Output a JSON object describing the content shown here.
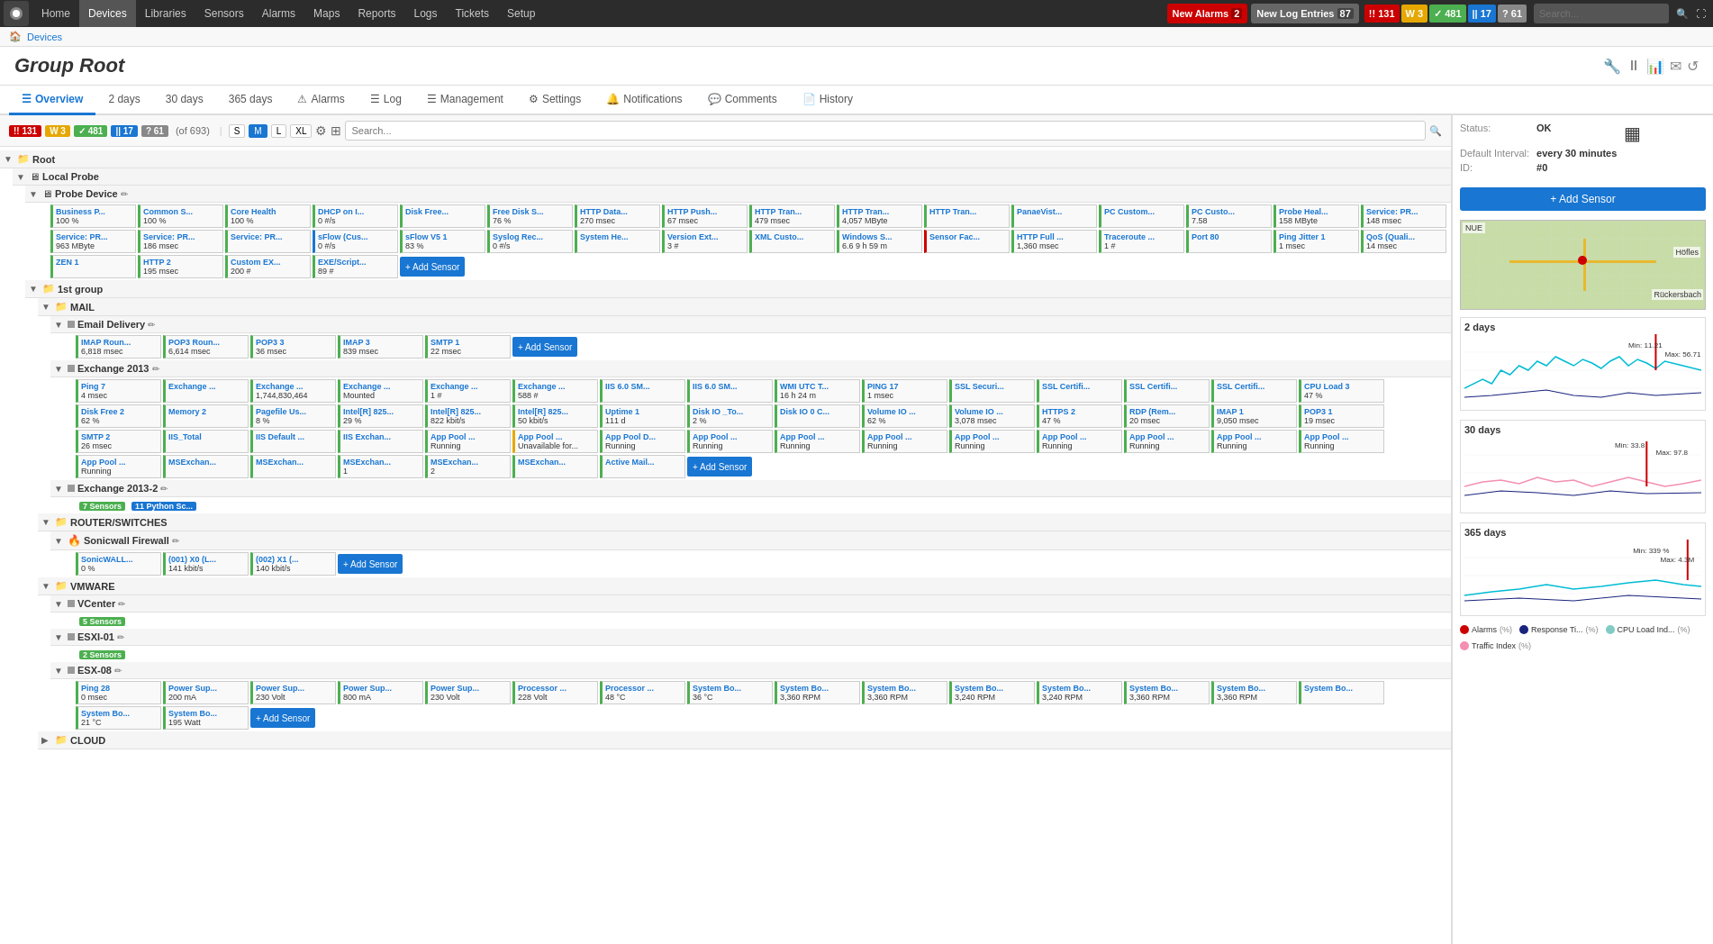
{
  "nav": {
    "logo": "⬤",
    "items": [
      "Home",
      "Devices",
      "Libraries",
      "Sensors",
      "Alarms",
      "Maps",
      "Reports",
      "Logs",
      "Tickets",
      "Setup"
    ],
    "active": "Devices"
  },
  "topbar": {
    "new_alarms_label": "New Alarms",
    "new_alarms_count": "2",
    "new_log_label": "New Log Entries",
    "new_log_count": "87",
    "badges": [
      {
        "value": "131",
        "type": "red",
        "prefix": "!!"
      },
      {
        "value": "3",
        "type": "yellow",
        "prefix": "W"
      },
      {
        "value": "481",
        "type": "green",
        "prefix": "✓"
      },
      {
        "value": "17",
        "type": "blue",
        "prefix": "||"
      },
      {
        "value": "61",
        "type": "gray",
        "prefix": "?"
      }
    ],
    "search_placeholder": "Search..."
  },
  "breadcrumb": [
    "Devices"
  ],
  "page_title": {
    "italic": "Group",
    "normal": " Root"
  },
  "tabs": [
    {
      "label": "Overview",
      "icon": "☰",
      "active": true
    },
    {
      "label": "2 days",
      "icon": ""
    },
    {
      "label": "30 days",
      "icon": ""
    },
    {
      "label": "365 days",
      "icon": ""
    },
    {
      "label": "Alarms",
      "icon": "⚠"
    },
    {
      "label": "Log",
      "icon": "☰"
    },
    {
      "label": "Management",
      "icon": "☰"
    },
    {
      "label": "Settings",
      "icon": "⚙"
    },
    {
      "label": "Notifications",
      "icon": "🔔"
    },
    {
      "label": "Comments",
      "icon": "💬"
    },
    {
      "label": "History",
      "icon": "📄"
    }
  ],
  "toolbar": {
    "counts": [
      {
        "val": "131",
        "type": "red",
        "prefix": "!!"
      },
      {
        "val": "3",
        "type": "yellow",
        "prefix": "W"
      },
      {
        "val": "481",
        "type": "green",
        "prefix": "✓"
      },
      {
        "val": "17",
        "type": "blue",
        "prefix": "||"
      },
      {
        "val": "61",
        "type": "gray",
        "prefix": "?"
      }
    ],
    "of_label": "(of 693)",
    "sizes": [
      "S",
      "M",
      "L",
      "XL"
    ],
    "active_size": "M",
    "search_placeholder": "Search..."
  },
  "status_panel": {
    "status_label": "Status:",
    "status_value": "OK",
    "interval_label": "Default Interval:",
    "interval_value": "every 30 minutes",
    "id_label": "ID:",
    "id_value": "#0",
    "add_sensor_label": "+ Add Sensor"
  },
  "tree": {
    "root_label": "Root",
    "local_probe_label": "Local Probe",
    "probe_device_label": "Probe Device",
    "group1_label": "1st group",
    "mail_label": "MAIL",
    "email_delivery_label": "Email Delivery",
    "exchange2013_label": "Exchange 2013",
    "exchange2013_2_label": "Exchange 2013-2",
    "router_label": "ROUTER/SWITCHES",
    "sonicwall_label": "Sonicwall Firewall",
    "vmware_label": "VMWARE",
    "vcenter_label": "VCenter",
    "esxi01_label": "ESXI-01",
    "esx08_label": "ESX-08",
    "cloud_label": "CLOUD"
  },
  "probe_tiles": [
    {
      "name": "Business P...",
      "value": "100 %",
      "status": "green"
    },
    {
      "name": "Common S...",
      "value": "100 %",
      "status": "green"
    },
    {
      "name": "Core Health",
      "value": "100 %",
      "status": "green"
    },
    {
      "name": "DHCP on I...",
      "value": "0 #/s",
      "status": "green"
    },
    {
      "name": "Disk Free...",
      "value": "",
      "status": "green"
    },
    {
      "name": "Free Disk S...",
      "value": "76 %",
      "status": "green"
    },
    {
      "name": "HTTP Data...",
      "value": "270 msec",
      "status": "green"
    },
    {
      "name": "HTTP Push...",
      "value": "67 msec",
      "status": "green"
    },
    {
      "name": "HTTP Tran...",
      "value": "479 msec",
      "status": "green"
    },
    {
      "name": "HTTP Tran...",
      "value": "4,057 MByte",
      "status": "green"
    },
    {
      "name": "HTTP Tran...",
      "value": "",
      "status": "green"
    },
    {
      "name": "PanaeVist...",
      "value": "",
      "status": "green"
    },
    {
      "name": "PC Custom...",
      "value": "",
      "status": "green"
    },
    {
      "name": "PC Custo...",
      "value": "7.58",
      "status": "green"
    },
    {
      "name": "Probe Heal...",
      "value": "158 MByte",
      "status": "green"
    },
    {
      "name": "Service: PR...",
      "value": "148 msec",
      "status": "green"
    },
    {
      "name": "Service: PR...",
      "value": "963 MByte",
      "status": "green"
    },
    {
      "name": "Service: PR...",
      "value": "186 msec",
      "status": "green"
    },
    {
      "name": "Service: PR...",
      "value": "",
      "status": "green"
    },
    {
      "name": "sFlow (Cus...",
      "value": "0 #/s",
      "status": "blue"
    },
    {
      "name": "sFlow V5 1",
      "value": "83 %",
      "status": "green"
    },
    {
      "name": "Syslog Rec...",
      "value": "0 #/s",
      "status": "green"
    },
    {
      "name": "System He...",
      "value": "",
      "status": "green"
    },
    {
      "name": "Version Ext...",
      "value": "3 #",
      "status": "green"
    },
    {
      "name": "XML Custo...",
      "value": "",
      "status": "green"
    },
    {
      "name": "Windows S...",
      "value": "6.6 9 h 59 m",
      "status": "green"
    },
    {
      "name": "Sensor Fac...",
      "value": "",
      "status": "red"
    },
    {
      "name": "HTTP Full ...",
      "value": "1,360 msec",
      "status": "green"
    },
    {
      "name": "Traceroute ...",
      "value": "1 #",
      "status": "green"
    },
    {
      "name": "Port 80",
      "value": "",
      "status": "green"
    },
    {
      "name": "Ping Jitter 1",
      "value": "1 msec",
      "status": "green"
    },
    {
      "name": "QoS (Quali...",
      "value": "14 msec",
      "status": "green"
    },
    {
      "name": "ZEN 1",
      "value": "",
      "status": "green"
    },
    {
      "name": "HTTP 2",
      "value": "195 msec",
      "status": "green"
    },
    {
      "name": "Custom EX...",
      "value": "200 #",
      "status": "green"
    },
    {
      "name": "EXE/Script...",
      "value": "89 #",
      "status": "green"
    }
  ],
  "email_delivery_tiles": [
    {
      "name": "IMAP Roun...",
      "value": "6,818 msec",
      "status": "green"
    },
    {
      "name": "POP3 Roun...",
      "value": "6,614 msec",
      "status": "green"
    },
    {
      "name": "POP3 3",
      "value": "36 msec",
      "status": "green"
    },
    {
      "name": "IMAP 3",
      "value": "839 msec",
      "status": "green"
    },
    {
      "name": "SMTP 1",
      "value": "22 msec",
      "status": "green"
    }
  ],
  "exchange_tiles": [
    {
      "name": "Ping 7",
      "value": "4 msec",
      "status": "green"
    },
    {
      "name": "Exchange ...",
      "value": "",
      "status": "green"
    },
    {
      "name": "Exchange ...",
      "value": "1,744,830,464",
      "status": "green"
    },
    {
      "name": "Exchange ...",
      "value": "Mounted",
      "status": "green"
    },
    {
      "name": "Exchange ...",
      "value": "1 #",
      "status": "green"
    },
    {
      "name": "Exchange ...",
      "value": "588 #",
      "status": "green"
    },
    {
      "name": "IIS 6.0 SM...",
      "value": "",
      "status": "green"
    },
    {
      "name": "IIS 6.0 SM...",
      "value": "",
      "status": "green"
    },
    {
      "name": "WMI UTC T...",
      "value": "16 h 24 m",
      "status": "green"
    },
    {
      "name": "PING 17",
      "value": "1 msec",
      "status": "green"
    },
    {
      "name": "SSL Securi...",
      "value": "",
      "status": "green"
    },
    {
      "name": "SSL Certifi...",
      "value": "",
      "status": "green"
    },
    {
      "name": "SSL Certifi...",
      "value": "",
      "status": "green"
    },
    {
      "name": "SSL Certifi...",
      "value": "",
      "status": "green"
    },
    {
      "name": "CPU Load 3",
      "value": "47 %",
      "status": "green"
    },
    {
      "name": "Disk Free 2",
      "value": "62 %",
      "status": "green"
    },
    {
      "name": "Memory 2",
      "value": "",
      "status": "green"
    },
    {
      "name": "Pagefile Us...",
      "value": "8 %",
      "status": "green"
    },
    {
      "name": "Intel[R] 825...",
      "value": "29 %",
      "status": "green"
    },
    {
      "name": "Intel[R] 825...",
      "value": "822 kbit/s",
      "status": "green"
    },
    {
      "name": "Intel[R] 825...",
      "value": "50 kbit/s",
      "status": "green"
    },
    {
      "name": "Uptime 1",
      "value": "111 d",
      "status": "green"
    },
    {
      "name": "Disk IO _To...",
      "value": "2 %",
      "status": "green"
    },
    {
      "name": "Disk IO 0 C...",
      "value": "",
      "status": "green"
    },
    {
      "name": "Volume IO ...",
      "value": "62 %",
      "status": "green"
    },
    {
      "name": "Volume IO ...",
      "value": "3,078 msec",
      "status": "green"
    },
    {
      "name": "HTTPS 2",
      "value": "47 %",
      "status": "green"
    },
    {
      "name": "RDP (Rem...",
      "value": "20 msec",
      "status": "green"
    },
    {
      "name": "IMAP 1",
      "value": "9,050 msec",
      "status": "green"
    },
    {
      "name": "POP3 1",
      "value": "19 msec",
      "status": "green"
    },
    {
      "name": "SMTP 2",
      "value": "26 msec",
      "status": "green"
    },
    {
      "name": "IIS_Total",
      "value": "",
      "status": "green"
    },
    {
      "name": "IIS Default ...",
      "value": "",
      "status": "green"
    },
    {
      "name": "IIS Exchan...",
      "value": "",
      "status": "green"
    },
    {
      "name": "App Pool ...",
      "value": "Running",
      "status": "green"
    },
    {
      "name": "App Pool ...",
      "value": "Unavailable for...",
      "status": "yellow"
    },
    {
      "name": "App Pool D...",
      "value": "Running",
      "status": "green"
    },
    {
      "name": "App Pool ...",
      "value": "Running",
      "status": "green"
    },
    {
      "name": "App Pool ...",
      "value": "Running",
      "status": "green"
    },
    {
      "name": "App Pool ...",
      "value": "Running",
      "status": "green"
    },
    {
      "name": "App Pool ...",
      "value": "Running",
      "status": "green"
    },
    {
      "name": "App Pool ...",
      "value": "Running",
      "status": "green"
    },
    {
      "name": "App Pool ...",
      "value": "Running",
      "status": "green"
    },
    {
      "name": "App Pool ...",
      "value": "Running",
      "status": "green"
    },
    {
      "name": "App Pool ...",
      "value": "Running",
      "status": "green"
    },
    {
      "name": "App Pool ...",
      "value": "Running",
      "status": "green"
    },
    {
      "name": "MSExchan...",
      "value": "",
      "status": "green"
    },
    {
      "name": "MSExchan...",
      "value": "",
      "status": "green"
    },
    {
      "name": "MSExchan...",
      "value": "1",
      "status": "green"
    },
    {
      "name": "MSExchan...",
      "value": "2",
      "status": "green"
    },
    {
      "name": "MSExchan...",
      "value": "",
      "status": "green"
    },
    {
      "name": "Active Mail...",
      "value": "",
      "status": "green"
    }
  ],
  "exchange2_badges": [
    {
      "label": "7 Sensors",
      "type": "green"
    },
    {
      "label": "11 Python Sc...",
      "type": "blue"
    }
  ],
  "sonicwall_tiles": [
    {
      "name": "SonicWALL...",
      "value": "0 %",
      "status": "green"
    },
    {
      "name": "(001) X0 (L...",
      "value": "141 kbit/s",
      "status": "green"
    },
    {
      "name": "(002) X1 (...",
      "value": "140 kbit/s",
      "status": "green"
    }
  ],
  "vcenter_badge": "5 Sensors",
  "esxi01_badge": "2 Sensors",
  "esx08_tiles": [
    {
      "name": "Ping 28",
      "value": "0 msec",
      "status": "green"
    },
    {
      "name": "Power Sup...",
      "value": "200 mA",
      "status": "green"
    },
    {
      "name": "Power Sup...",
      "value": "230 Volt",
      "status": "green"
    },
    {
      "name": "Power Sup...",
      "value": "800 mA",
      "status": "green"
    },
    {
      "name": "Power Sup...",
      "value": "230 Volt",
      "status": "green"
    },
    {
      "name": "Processor ...",
      "value": "228 Volt",
      "status": "green"
    },
    {
      "name": "Processor ...",
      "value": "48 °C",
      "status": "green"
    },
    {
      "name": "System Bo...",
      "value": "36 °C",
      "status": "green"
    },
    {
      "name": "System Bo...",
      "value": "3,360 RPM",
      "status": "green"
    },
    {
      "name": "System Bo...",
      "value": "3,360 RPM",
      "status": "green"
    },
    {
      "name": "System Bo...",
      "value": "3,240 RPM",
      "status": "green"
    },
    {
      "name": "System Bo...",
      "value": "3,240 RPM",
      "status": "green"
    },
    {
      "name": "System Bo...",
      "value": "3,360 RPM",
      "status": "green"
    },
    {
      "name": "System Bo...",
      "value": "3,360 RPM",
      "status": "green"
    },
    {
      "name": "System Bo...",
      "value": "",
      "status": "green"
    },
    {
      "name": "System Bo...",
      "value": "21 °C",
      "status": "green"
    },
    {
      "name": "System Bo...",
      "value": "195 Watt",
      "status": "green"
    }
  ],
  "charts": {
    "days2_label": "2 days",
    "days30_label": "30 days",
    "days365_label": "365 days"
  },
  "legend": [
    {
      "label": "Alarms",
      "color": "#cc0000",
      "unit": "(%)"
    },
    {
      "label": "Response Ti...",
      "color": "#1a237e",
      "unit": "(%)"
    },
    {
      "label": "CPU Load Ind...",
      "color": "#80cbc4",
      "unit": "(%)"
    },
    {
      "label": "Traffic Index",
      "color": "#f48fb1",
      "unit": "(%)"
    }
  ]
}
